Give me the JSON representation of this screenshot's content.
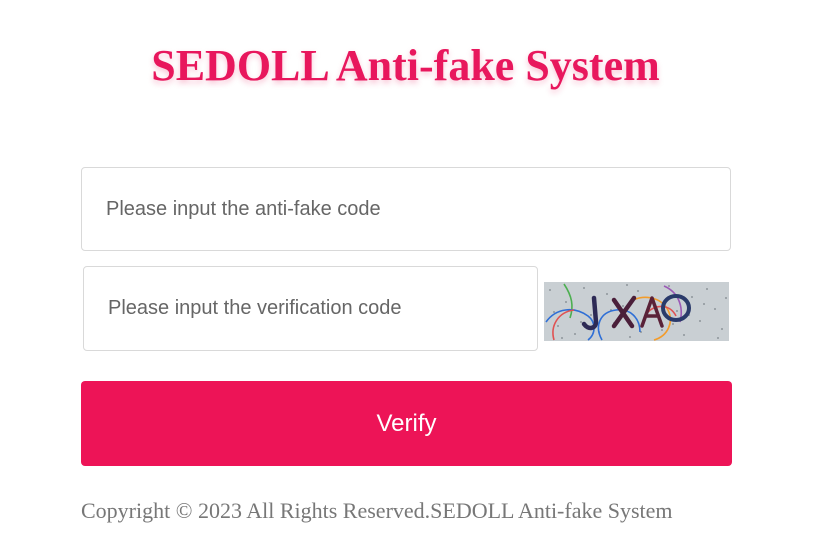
{
  "header": {
    "title": "SEDOLL Anti-fake System"
  },
  "form": {
    "anti_fake_placeholder": "Please input the anti-fake code",
    "anti_fake_value": "",
    "verification_placeholder": "Please input the verification code",
    "verification_value": "",
    "captcha_text": "JXAO",
    "verify_label": "Verify"
  },
  "footer": {
    "copyright": "Copyright © 2023 All Rights Reserved.SEDOLL Anti-fake System"
  },
  "colors": {
    "brand": "#ed1457",
    "title": "#e8175d",
    "captcha_bg": "#c9cfd3"
  }
}
